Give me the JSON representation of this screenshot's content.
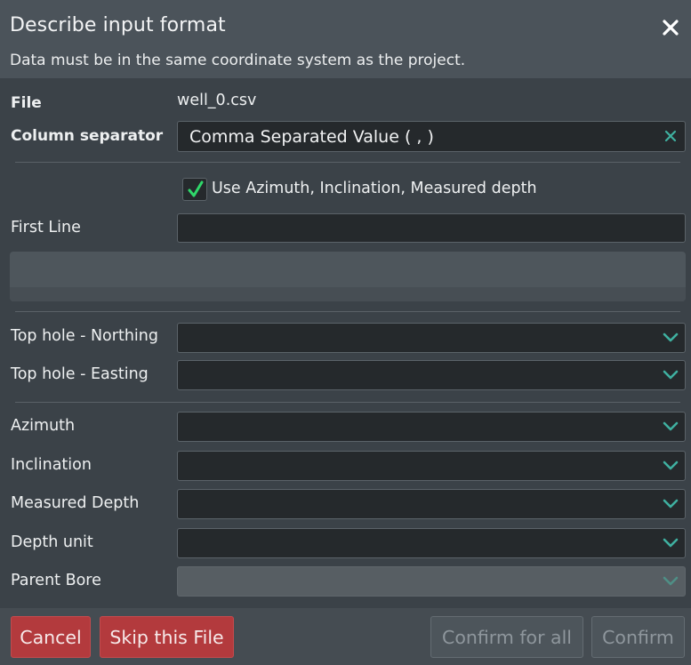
{
  "dialog": {
    "title": "Describe input format",
    "subtitle": "Data must be in the same coordinate system as the project."
  },
  "file": {
    "label": "File",
    "value": "well_0.csv"
  },
  "separator": {
    "label": "Column separator",
    "value": "Comma Separated Value ( , )"
  },
  "use_aim": {
    "checked": true,
    "label": "Use Azimuth, Inclination, Measured depth"
  },
  "first_line": {
    "label": "First Line",
    "value": ""
  },
  "fields": {
    "northing": {
      "label": "Top hole - Northing",
      "value": ""
    },
    "easting": {
      "label": "Top hole - Easting",
      "value": ""
    },
    "azimuth": {
      "label": "Azimuth",
      "value": ""
    },
    "inclination": {
      "label": "Inclination",
      "value": ""
    },
    "measured_depth": {
      "label": "Measured Depth",
      "value": ""
    },
    "depth_unit": {
      "label": "Depth unit",
      "value": ""
    },
    "parent_bore": {
      "label": "Parent Bore",
      "value": "",
      "disabled": true
    }
  },
  "buttons": {
    "cancel": "Cancel",
    "skip": "Skip this File",
    "confirm_all": "Confirm for all",
    "confirm": "Confirm"
  },
  "colors": {
    "accent_chevron": "#3fb0a0",
    "danger_button": "#b33a3d",
    "check": "#2fd86a"
  },
  "icons": {
    "close": "close-icon",
    "clear": "clear-x-icon",
    "chevron": "chevron-down-icon",
    "check": "checkmark-icon"
  }
}
